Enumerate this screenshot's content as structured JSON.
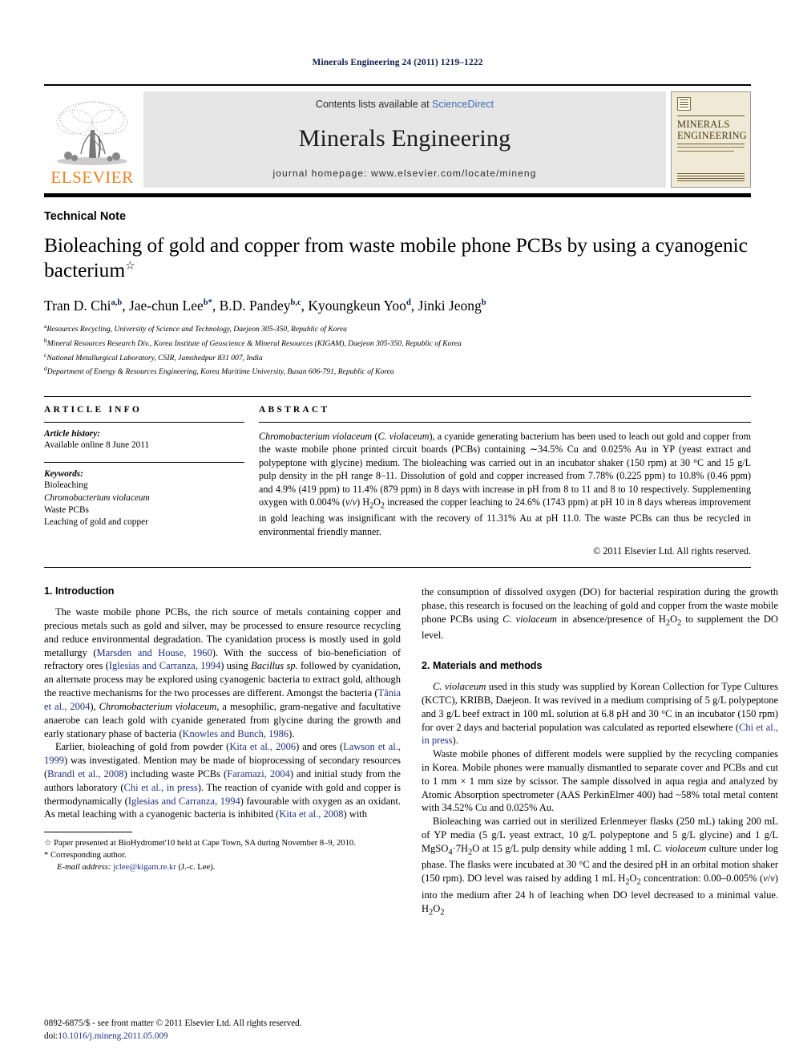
{
  "running_head": "Minerals Engineering 24 (2011) 1219–1222",
  "masthead": {
    "publisher_logo_text": "ELSEVIER",
    "contents_prefix": "Contents lists available at",
    "contents_link": "ScienceDirect",
    "journal_name": "Minerals Engineering",
    "homepage_line": "journal homepage: www.elsevier.com/locate/mineng",
    "cover_title_line1": "MINERALS",
    "cover_title_line2": "ENGINEERING"
  },
  "article": {
    "kind": "Technical Note",
    "title": "Bioleaching of gold and copper from waste mobile phone PCBs by using a cyanogenic bacterium",
    "title_mark": "☆",
    "authors": [
      {
        "name": "Tran D. Chi",
        "sup": "a,b",
        "sep": ","
      },
      {
        "name": "Jae-chun Lee",
        "sup": "b*",
        "sep": ","
      },
      {
        "name": "B.D. Pandey",
        "sup": "b,c",
        "sep": ","
      },
      {
        "name": "Kyoungkeun Yoo",
        "sup": "d",
        "sep": ","
      },
      {
        "name": "Jinki Jeong",
        "sup": "b",
        "sep": ""
      }
    ],
    "affiliations": [
      {
        "mark": "a",
        "text": "Resources Recycling, University of Science and Technology, Daejeon 305-350, Republic of Korea"
      },
      {
        "mark": "b",
        "text": "Mineral Resources Research Div., Korea Institute of Geoscience & Mineral Resources (KIGAM), Daejeon 305-350, Republic of Korea"
      },
      {
        "mark": "c",
        "text": "National Metallurgical Laboratory, CSIR, Jamshedpur 831 007, India"
      },
      {
        "mark": "d",
        "text": "Department of Energy & Resources Engineering, Korea Maritime University, Busan 606-791, Republic of Korea"
      }
    ]
  },
  "article_info": {
    "heading": "ARTICLE INFO",
    "history_label": "Article history:",
    "history_value": "Available online 8 June 2011",
    "keywords_label": "Keywords:",
    "keywords": [
      "Bioleaching",
      "Chromobacterium violaceum",
      "Waste PCBs",
      "Leaching of gold and copper"
    ]
  },
  "abstract": {
    "heading": "ABSTRACT",
    "body": "Chromobacterium violaceum (C. violaceum), a cyanide generating bacterium has been used to leach out gold and copper from the waste mobile phone printed circuit boards (PCBs) containing ~34.5% Cu and 0.025% Au in YP (yeast extract and polypeptone with glycine) medium. The bioleaching was carried out in an incubator shaker (150 rpm) at 30 °C and 15 g/L pulp density in the pH range 8–11. Dissolution of gold and copper increased from 7.78% (0.225 ppm) to 10.8% (0.46 ppm) and 4.9% (419 ppm) to 11.4% (879 ppm) in 8 days with increase in pH from 8 to 11 and 8 to 10 respectively. Supplementing oxygen with 0.004% (v/v) H2O2 increased the copper leaching to 24.6% (1743 ppm) at pH 10 in 8 days whereas improvement in gold leaching was insignificant with the recovery of 11.31% Au at pH 11.0. The waste PCBs can thus be recycled in environmental friendly manner.",
    "copyright": "© 2011 Elsevier Ltd. All rights reserved."
  },
  "sections": {
    "introduction_heading": "1. Introduction",
    "materials_heading": "2. Materials and methods"
  },
  "left_column": {
    "p1_a": "The waste mobile phone PCBs, the rich source of metals containing copper and precious metals such as gold and silver, may be processed to ensure resource recycling and reduce environmental degradation. The cyanidation process is mostly used in gold metallurgy (",
    "p1_ref1": "Marsden and House, 1960",
    "p1_b": "). With the success of bio-beneficiation of refractory ores (",
    "p1_ref2": "Iglesias and Carranza, 1994",
    "p1_c": ") using ",
    "p1_ital1": "Bacillus sp.",
    "p1_d": " followed by cyanidation, an alternate process may be explored using cyanogenic bacteria to extract gold, although the reactive mechanisms for the two processes are different. Amongst the bacteria (",
    "p1_ref3": "Tânia et al., 2004",
    "p1_e": "), ",
    "p1_ital2": "Chromobacterium violaceum",
    "p1_f": ", a mesophilic, gram-negative and facultative anaerobe can leach gold with cyanide generated from glycine during the growth and early stationary phase of bacteria (",
    "p1_ref4": "Knowles and Bunch, 1986",
    "p1_g": ").",
    "p2_a": "Earlier, bioleaching of gold from powder (",
    "p2_ref1": "Kita et al., 2006",
    "p2_b": ") and ores (",
    "p2_ref2": "Lawson et al., 1999",
    "p2_c": ") was investigated. Mention may be made of bioprocessing of secondary resources (",
    "p2_ref3": "Brandl et al., 2008",
    "p2_d": ") including waste PCBs (",
    "p2_ref4": "Faramazi, 2004",
    "p2_e": ") and initial study from the authors laboratory (",
    "p2_ref5": "Chi et al., in press",
    "p2_f": "). The reaction of cyanide with gold and copper is thermodynamically (",
    "p2_ref6": "Iglesias and Carranza, 1994",
    "p2_g": ") favourable with oxygen as an oxidant. As metal leaching with a cyanogenic bacteria is inhibited (",
    "p2_ref7": "Kita et al., 2008",
    "p2_h": ") with"
  },
  "right_column": {
    "p1": "the consumption of dissolved oxygen (DO) for bacterial respiration during the growth phase, this research is focused on the leaching of gold and copper from the waste mobile phone PCBs using ",
    "p1_ital": "C. violaceum",
    "p1_b": " in absence/presence of H2O2 to supplement the DO level.",
    "p2_ital": "C. violaceum",
    "p2_a": " used in this study was supplied by Korean Collection for Type Cultures (KCTC), KRIBB, Daejeon. It was revived in a medium comprising of 5 g/L polypeptone and 3 g/L beef extract in 100 mL solution at 6.8 pH and 30 °C in an incubator (150 rpm) for over 2 days and bacterial population was calculated as reported elsewhere (",
    "p2_ref": "Chi et al., in press",
    "p2_b": ").",
    "p3": "Waste mobile phones of different models were supplied by the recycling companies in Korea. Mobile phones were manually dismantled to separate cover and PCBs and cut to 1 mm × 1 mm size by scissor. The sample dissolved in aqua regia and analyzed by Atomic Absorption spectrometer (AAS PerkinElmer 400) had ~58% total metal content with 34.52% Cu and 0.025% Au.",
    "p4_a": "Bioleaching was carried out in sterilized Erlenmeyer flasks (250 mL) taking 200 mL of YP media (5 g/L yeast extract, 10 g/L polypeptone and 5 g/L glycine) and 1 g/L MgSO4·7H2O at 15 g/L pulp density while adding 1 mL ",
    "p4_ital": "C. violaceum",
    "p4_b": " culture under log phase. The flasks were incubated at 30 °C and the desired pH in an orbital motion shaker (150 rpm). DO level was raised by adding 1 mL H2O2 concentration: 0.00–0.005% (v/v) into the medium after 24 h of leaching when DO level decreased to a minimal value. H2O2"
  },
  "footnotes": {
    "star_symbol": "☆",
    "star_text": "Paper presented at BioHydromet'10 held at Cape Town, SA during November 8–9, 2010.",
    "corr_symbol": "*",
    "corr_text": "Corresponding author.",
    "email_label": "E-mail address:",
    "email_value": "jclee@kigam.re.kr",
    "email_suffix": "(J.-c. Lee)."
  },
  "page_footer": {
    "issn_line": "0892-6875/$ - see front matter © 2011 Elsevier Ltd. All rights reserved.",
    "doi_label": "doi:",
    "doi_value": "10.1016/j.mineng.2011.05.009"
  },
  "colors": {
    "elsevier_orange": "#f0801a",
    "link_blue": "#3b6fb6",
    "reference_blue": "#1f2f86",
    "masthead_grey": "#e6e6e6",
    "cover_cream": "#efe9d5"
  }
}
